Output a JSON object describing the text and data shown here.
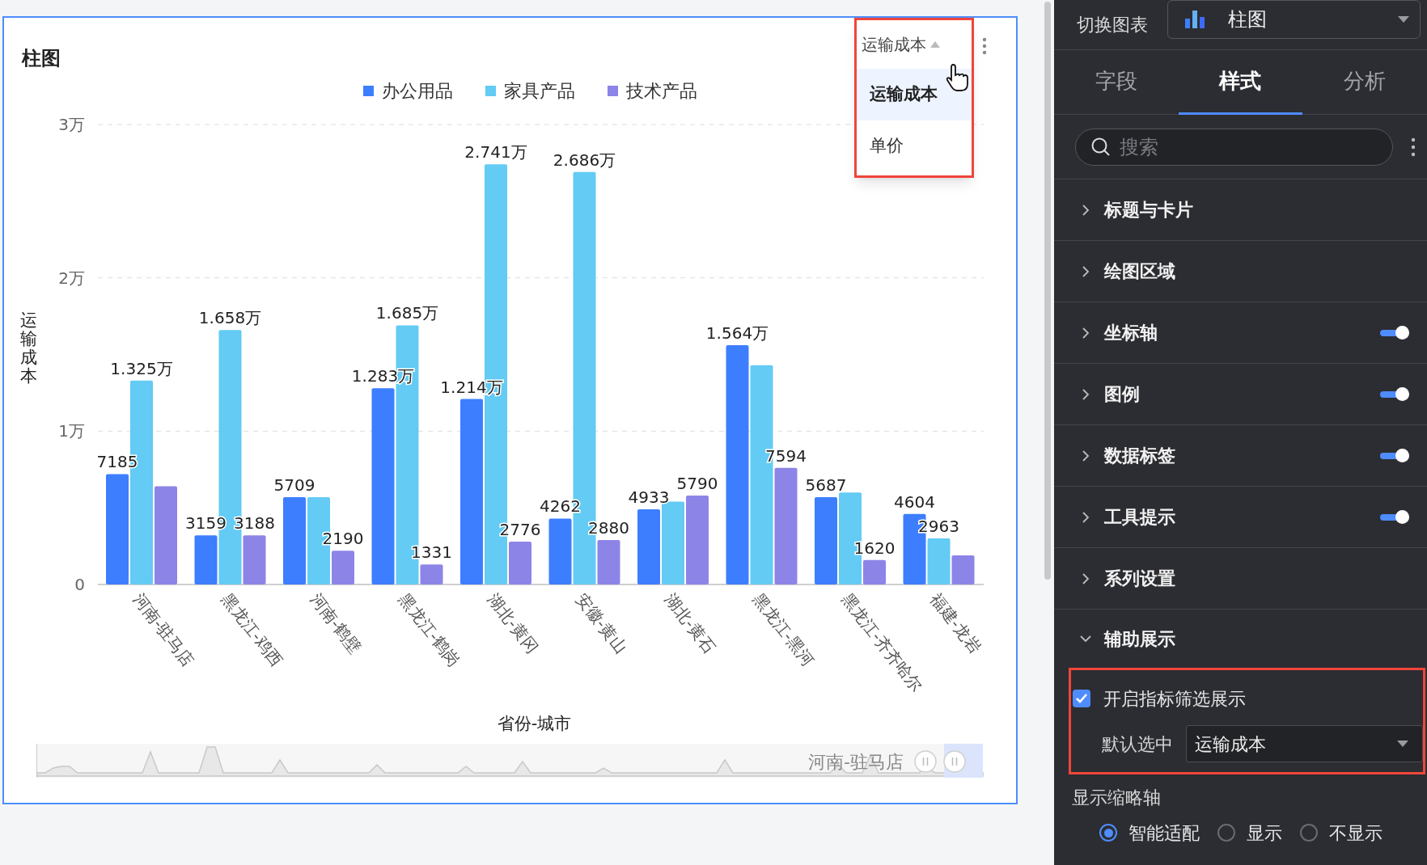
{
  "chart_card": {
    "title": "柱图",
    "metric_dropdown": {
      "value": "运输成本",
      "open": true,
      "options": [
        {
          "label": "运输成本",
          "selected": true
        },
        {
          "label": "单价",
          "selected": false
        }
      ]
    },
    "chart_data": {
      "type": "bar",
      "xlabel": "省份-城市",
      "ylabel": "运输成本",
      "categories": [
        "河南-驻马店",
        "黑龙江-鸡西",
        "河南-鹤壁",
        "黑龙江-鹤岗",
        "湖北-黄冈",
        "安徽-黄山",
        "湖北-黄石",
        "黑龙江-黑河",
        "黑龙江-齐齐哈尔",
        "福建-龙岩"
      ],
      "series": [
        {
          "name": "办公用品",
          "color": "#3d7eff",
          "values": [
            0.72,
            0.32,
            0.57,
            1.28,
            1.21,
            0.43,
            0.49,
            1.56,
            0.57,
            0.46
          ]
        },
        {
          "name": "家具产品",
          "color": "#63cbf4",
          "values": [
            1.33,
            1.66,
            0.57,
            1.69,
            2.74,
            2.69,
            0.54,
            1.43,
            0.6,
            0.3
          ]
        },
        {
          "name": "技术产品",
          "color": "#8d84e8",
          "values": [
            0.64,
            0.32,
            0.22,
            0.13,
            0.28,
            0.29,
            0.58,
            0.76,
            0.16,
            0.19
          ]
        }
      ],
      "ylim": [
        0,
        3
      ],
      "yticks": [
        {
          "value": 0,
          "label": "0"
        },
        {
          "value": 1,
          "label": "1万"
        },
        {
          "value": 2,
          "label": "2万"
        },
        {
          "value": 3,
          "label": "3万"
        }
      ],
      "value_labels": [
        [
          "7185",
          "3159",
          "5709",
          "1.283万",
          "1.214万",
          "4262",
          "4933",
          "1.564万",
          "5687",
          "4604"
        ],
        [
          "1.325万",
          "1.658万",
          null,
          "1.685万",
          "2.741万",
          "2.686万",
          null,
          null,
          null,
          "2963"
        ],
        [
          null,
          "3188",
          "2190",
          "1331",
          "2776",
          "2880",
          "5790",
          "7594",
          "1620",
          null
        ]
      ]
    },
    "brush": {
      "label": "河南-驻马店"
    }
  },
  "settings_panel": {
    "chart_switch": {
      "label": "切换图表",
      "value": "柱图"
    },
    "tabs": [
      {
        "label": "字段",
        "selected": false
      },
      {
        "label": "样式",
        "selected": true
      },
      {
        "label": "分析",
        "selected": false
      }
    ],
    "search": {
      "placeholder": "搜索"
    },
    "sections": [
      {
        "title": "标题与卡片",
        "expanded": false
      },
      {
        "title": "绘图区域",
        "expanded": false
      },
      {
        "title": "坐标轴",
        "expanded": false,
        "switch_on": true
      },
      {
        "title": "图例",
        "expanded": false,
        "switch_on": true
      },
      {
        "title": "数据标签",
        "expanded": false,
        "switch_on": true
      },
      {
        "title": "工具提示",
        "expanded": false,
        "switch_on": true
      },
      {
        "title": "系列设置",
        "expanded": false
      },
      {
        "title": "辅助展示",
        "expanded": true
      }
    ],
    "indicator_filter": {
      "label": "开启指标筛选展示",
      "checked": true,
      "default_label": "默认选中",
      "default_value": "运输成本"
    },
    "thumbnail_axis": {
      "label": "显示缩略轴",
      "options": [
        {
          "label": "智能适配",
          "selected": true
        },
        {
          "label": "显示",
          "selected": false
        },
        {
          "label": "不显示",
          "selected": false
        }
      ]
    }
  }
}
